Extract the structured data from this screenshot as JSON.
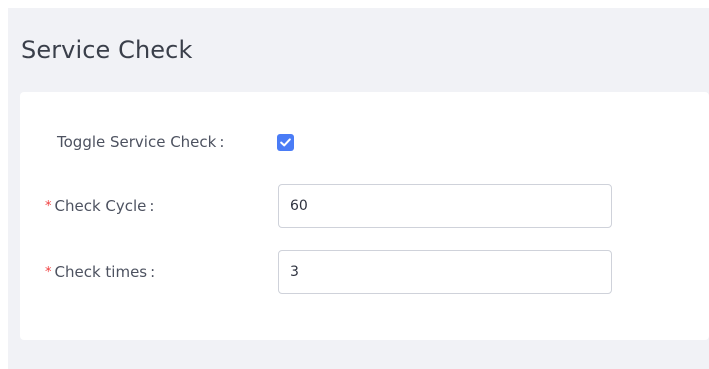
{
  "section": {
    "title": "Service Check"
  },
  "form": {
    "toggle_service_check": {
      "label": "Toggle Service Check",
      "colon": ":",
      "checked": true,
      "icon": "checkmark-icon"
    },
    "check_cycle": {
      "required_mark": "*",
      "label": "Check Cycle",
      "colon": ":",
      "value": "60"
    },
    "check_times": {
      "required_mark": "*",
      "label": "Check times",
      "colon": ":",
      "value": "3"
    }
  },
  "colors": {
    "page_background": "#f1f2f6",
    "card_background": "#ffffff",
    "accent": "#4a7cf6",
    "required": "#f03e3e",
    "label_text": "#4d5260",
    "input_border": "#cfd2da"
  }
}
